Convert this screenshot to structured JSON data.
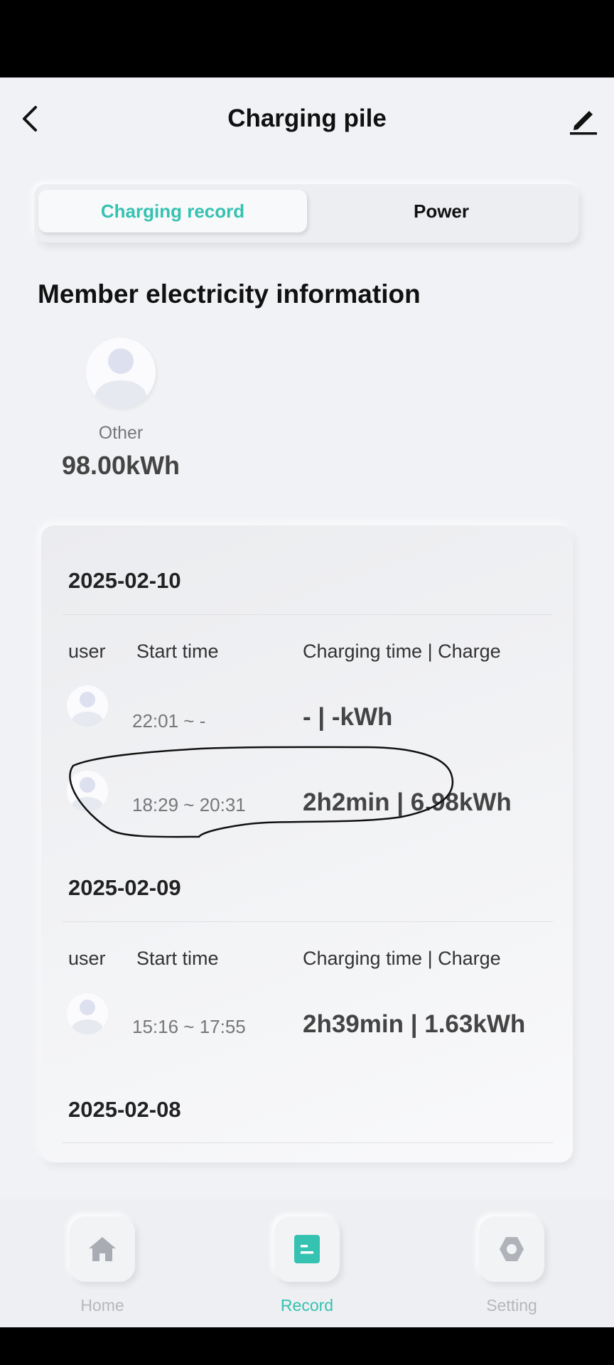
{
  "header": {
    "title": "Charging pile"
  },
  "tabs": {
    "active_label": "Charging record",
    "inactive_label": "Power"
  },
  "section_title": "Member electricity information",
  "member": {
    "name": "Other",
    "energy": "98.00kWh"
  },
  "records": {
    "columns": {
      "user": "user",
      "start": "Start time",
      "charge": "Charging time | Charge"
    },
    "groups": [
      {
        "date": "2025-02-10",
        "rows": [
          {
            "time": "22:01 ~ -",
            "value": "- | -kWh"
          },
          {
            "time": "18:29 ~ 20:31",
            "value": "2h2min | 6.98kWh"
          }
        ]
      },
      {
        "date": "2025-02-09",
        "rows": [
          {
            "time": "15:16 ~ 17:55",
            "value": "2h39min | 1.63kWh"
          }
        ]
      },
      {
        "date": "2025-02-08",
        "rows": []
      }
    ]
  },
  "nav": {
    "home": "Home",
    "record": "Record",
    "setting": "Setting"
  },
  "colors": {
    "accent": "#35c2b0",
    "background": "#f1f2f5",
    "inactive_nav": "#b5b7bb"
  }
}
